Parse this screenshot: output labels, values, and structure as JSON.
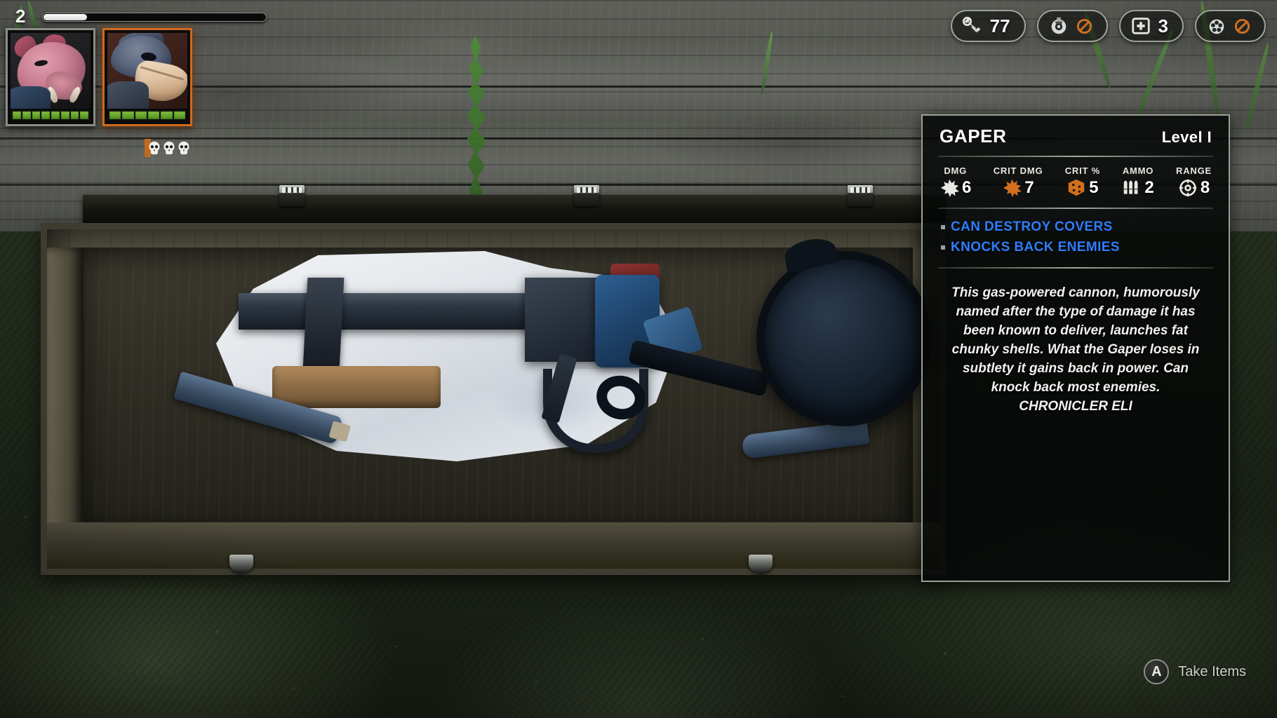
{
  "hud": {
    "turn_counter": "2",
    "progress_percent": 20,
    "characters": [
      {
        "name": "boar-character",
        "selected": false,
        "health_pips": 8,
        "portrait": "boar-portrait"
      },
      {
        "name": "bird-character",
        "selected": true,
        "health_pips": 6,
        "portrait": "shoebill-portrait"
      }
    ],
    "action_points": {
      "icon": "skull-icon",
      "count": 3
    },
    "resources": [
      {
        "icon": "scrap-bolt-icon",
        "value": "77",
        "disabled": false
      },
      {
        "icon": "grenade-icon",
        "value": "",
        "disabled": true
      },
      {
        "icon": "medkit-icon",
        "value": "3",
        "disabled": false
      },
      {
        "icon": "gun-parts-icon",
        "value": "",
        "disabled": true
      }
    ]
  },
  "tooltip": {
    "name": "GAPER",
    "level": "Level I",
    "stats": [
      {
        "label": "DMG",
        "value": "6",
        "icon": "damage-burst-icon",
        "color": "#e8e8e4"
      },
      {
        "label": "CRIT DMG",
        "value": "7",
        "icon": "crit-damage-burst-icon",
        "color": "#d2701f"
      },
      {
        "label": "CRIT %",
        "value": "5",
        "icon": "crit-dice-icon",
        "color": "#d2701f"
      },
      {
        "label": "AMMO",
        "value": "2",
        "icon": "ammo-bullets-icon",
        "color": "#e8e8e4"
      },
      {
        "label": "RANGE",
        "value": "8",
        "icon": "range-crosshair-icon",
        "color": "#e8e8e4"
      }
    ],
    "traits": [
      "CAN DESTROY COVERS",
      "KNOCKS BACK ENEMIES"
    ],
    "trait_color": "#2f7dff",
    "description": "This gas-powered cannon, humorously named after the type of damage it has been known to deliver, launches fat chunky shells. What the Gaper loses in subtlety it gains back in power. Can knock back most enemies. CHRONICLER ELI"
  },
  "prompt": {
    "button": "A",
    "label": "Take Items"
  },
  "scene": {
    "container": "open-wooden-crate",
    "items": [
      "wrapped-gas-cannon",
      "cast-iron-skillet",
      "razor-blade-left",
      "razor-blade-right"
    ]
  }
}
